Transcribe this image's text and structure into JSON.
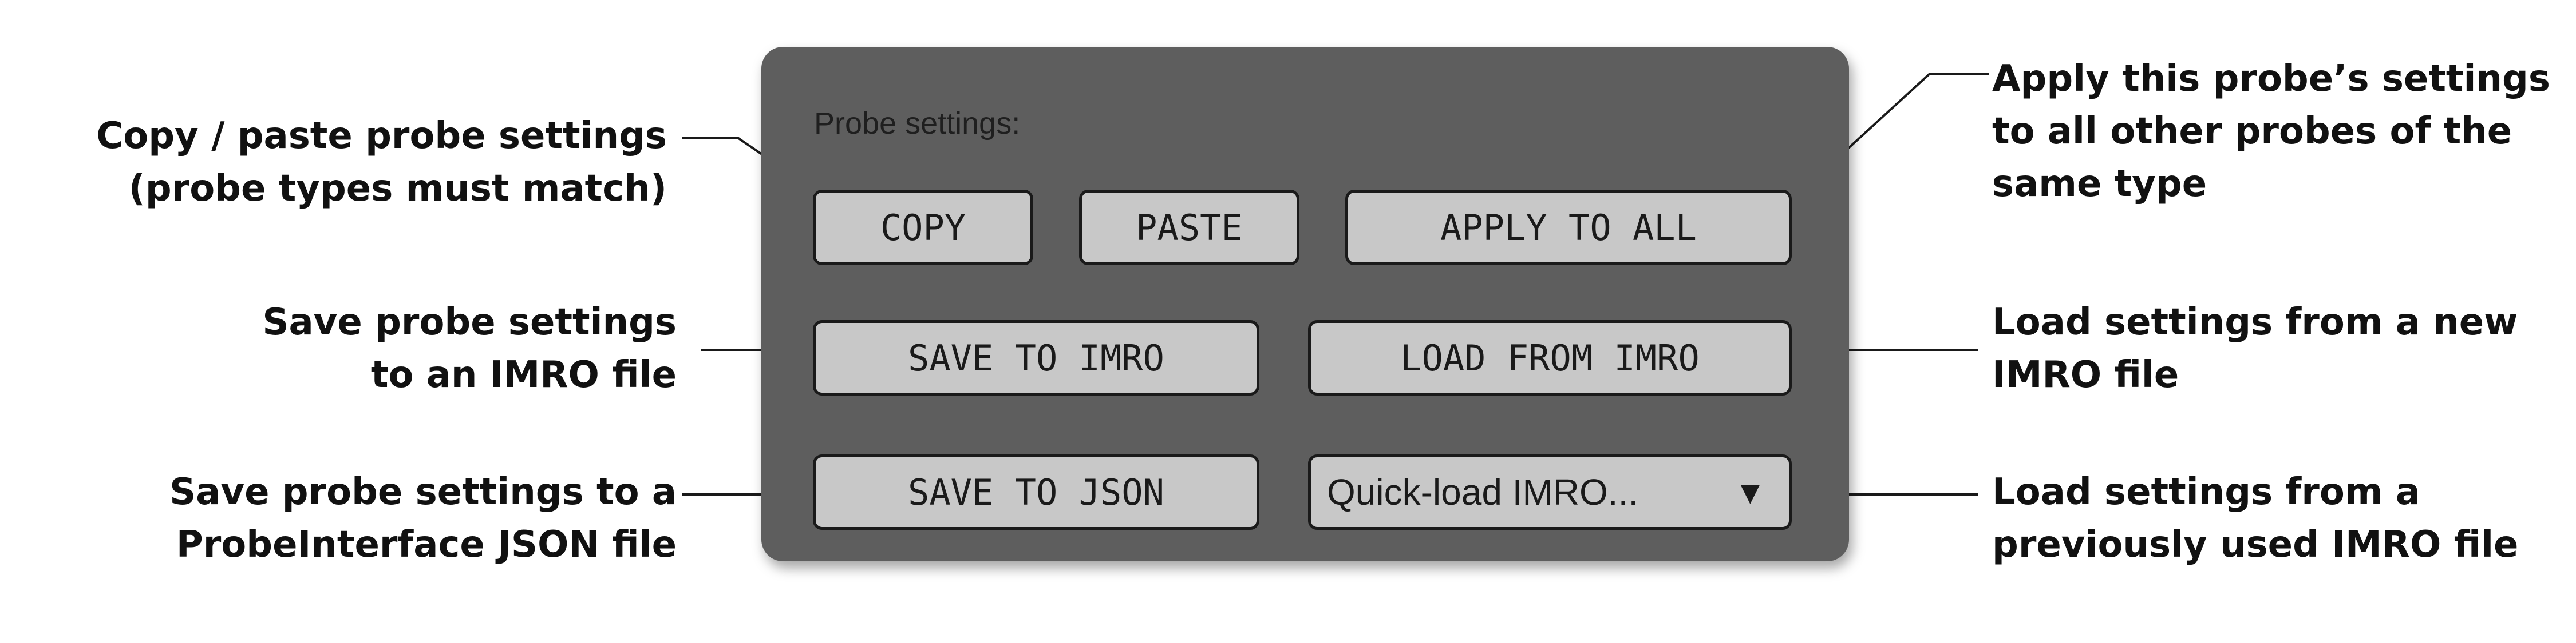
{
  "panel": {
    "title": "Probe settings:",
    "buttons": {
      "copy": "COPY",
      "paste": "PASTE",
      "apply_to_all": "APPLY TO ALL",
      "save_to_imro": "SAVE TO IMRO",
      "load_from_imro": "LOAD FROM IMRO",
      "save_to_json": "SAVE TO JSON"
    },
    "quick_load": {
      "label": "Quick-load IMRO...",
      "arrow": "▼"
    }
  },
  "annotations": {
    "copy_paste": [
      "Copy / paste probe settings",
      "(probe types must match)"
    ],
    "apply": [
      "Apply this probe’s settings",
      "to all other probes of the",
      "same type"
    ],
    "save_imro": [
      "Save probe settings",
      "to an IMRO file"
    ],
    "load_imro": [
      "Load settings from a new",
      "IMRO file"
    ],
    "save_json": [
      "Save probe settings to a",
      "ProbeInterface JSON file"
    ],
    "quick_load": [
      "Load settings from a",
      "previously used IMRO file"
    ]
  },
  "colors": {
    "panel": "#5e5e5e",
    "button": "#c8c8c8",
    "border": "#1a1a1a",
    "text": "#111111"
  }
}
